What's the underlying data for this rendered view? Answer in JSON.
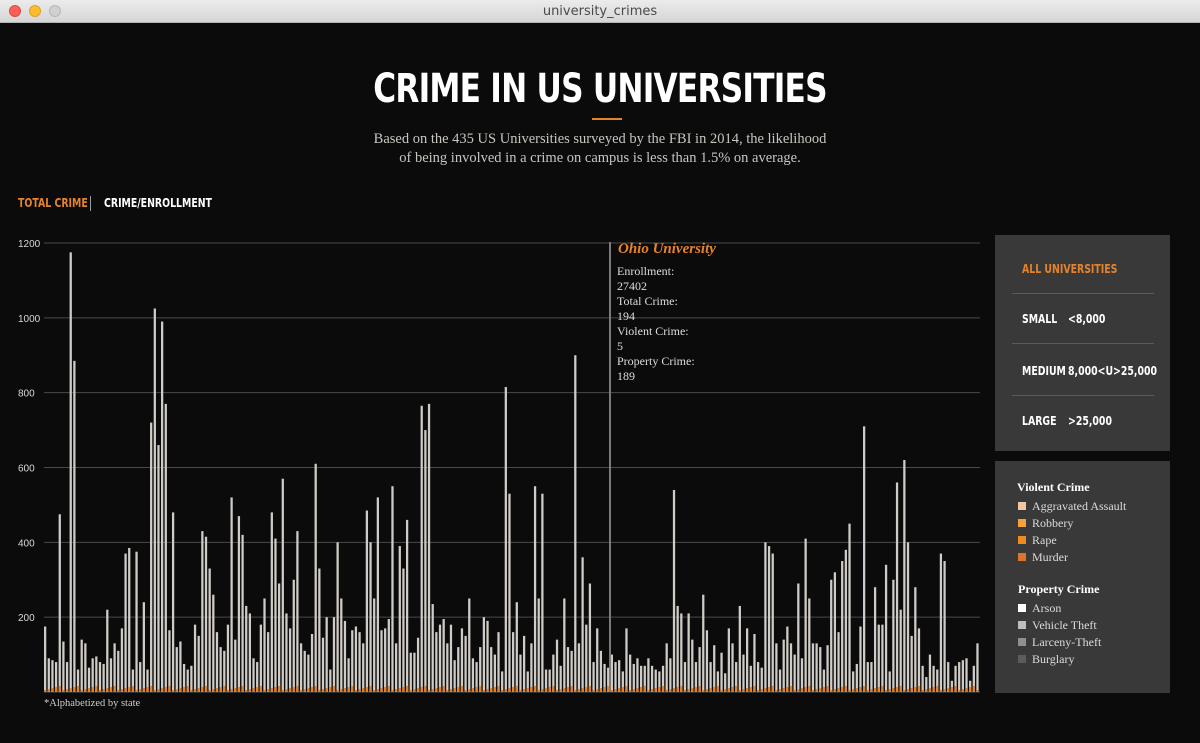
{
  "window": {
    "title": "university_crimes"
  },
  "header": {
    "title": "CRIME IN US UNIVERSITIES",
    "subtitle_line1": "Based on the 435 US Universities surveyed by the FBI in 2014, the likelihood",
    "subtitle_line2": "of being involved in a crime on campus is less than 1.5% on average."
  },
  "tabs": {
    "total": "TOTAL CRIME",
    "ratio": "CRIME/ENROLLMENT"
  },
  "size_filter": {
    "all": "ALL UNIVERSITIES",
    "small": {
      "label": "SMALL",
      "range": "<8,000"
    },
    "medium": {
      "label": "MEDIUM",
      "range": "8,000<U>25,000"
    },
    "large": {
      "label": "LARGE",
      "range": ">25,000"
    }
  },
  "legend": {
    "violent_title": "Violent Crime",
    "violent": [
      {
        "label": "Aggravated Assault",
        "color": "#f3c6a2"
      },
      {
        "label": "Robbery",
        "color": "#f6a23a"
      },
      {
        "label": "Rape",
        "color": "#f08a1f"
      },
      {
        "label": "Murder",
        "color": "#e0742a"
      }
    ],
    "property_title": "Property Crime",
    "property": [
      {
        "label": "Arson",
        "color": "#ffffff"
      },
      {
        "label": "Vehicle Theft",
        "color": "#bdbdbd"
      },
      {
        "label": "Larceny-Theft",
        "color": "#8f8f8f"
      },
      {
        "label": "Burglary",
        "color": "#5c5c5c"
      }
    ]
  },
  "footnote": "*Alphabetized by state",
  "tooltip": {
    "name": "Ohio University",
    "enrollment_label": "Enrollment:",
    "enrollment": "27402",
    "total_label": "Total Crime:",
    "total": "194",
    "violent_label": "Violent Crime:",
    "violent": "5",
    "property_label": "Property Crime:",
    "property": "189"
  },
  "chart_data": {
    "type": "bar",
    "stacked": true,
    "highlighted": "Ohio University",
    "y_ticks": [
      "200",
      "400",
      "600",
      "800",
      "1000",
      "1200"
    ],
    "ylim": [
      0,
      1200
    ],
    "values": [
      175,
      90,
      85,
      80,
      475,
      135,
      80,
      1175,
      885,
      60,
      140,
      130,
      65,
      90,
      95,
      80,
      75,
      220,
      90,
      130,
      110,
      170,
      370,
      385,
      60,
      375,
      80,
      240,
      60,
      720,
      1025,
      660,
      990,
      770,
      165,
      480,
      120,
      135,
      75,
      60,
      70,
      180,
      150,
      430,
      415,
      330,
      260,
      160,
      120,
      110,
      180,
      520,
      140,
      470,
      420,
      230,
      210,
      90,
      80,
      180,
      250,
      160,
      480,
      410,
      290,
      570,
      210,
      170,
      300,
      430,
      130,
      110,
      100,
      155,
      610,
      330,
      145,
      200,
      60,
      200,
      400,
      250,
      190,
      90,
      165,
      175,
      160,
      130,
      485,
      400,
      250,
      520,
      165,
      170,
      195,
      550,
      130,
      390,
      330,
      460,
      105,
      105,
      145,
      765,
      700,
      770,
      235,
      160,
      180,
      195,
      130,
      180,
      85,
      120,
      170,
      150,
      250,
      90,
      80,
      120,
      200,
      190,
      120,
      100,
      160,
      55,
      815,
      530,
      160,
      240,
      100,
      150,
      55,
      130,
      550,
      250,
      530,
      60,
      60,
      100,
      140,
      70,
      250,
      120,
      110,
      900,
      130,
      360,
      180,
      290,
      80,
      170,
      110,
      75,
      65,
      100,
      80,
      85,
      55,
      170,
      100,
      75,
      90,
      70,
      70,
      90,
      70,
      60,
      55,
      70,
      130,
      90,
      540,
      230,
      210,
      80,
      210,
      140,
      80,
      120,
      260,
      165,
      80,
      125,
      55,
      105,
      50,
      170,
      130,
      80,
      230,
      100,
      170,
      70,
      155,
      80,
      65,
      400,
      390,
      370,
      130,
      60,
      140,
      175,
      130,
      100,
      290,
      90,
      410,
      250,
      130,
      130,
      120,
      60,
      125,
      300,
      320,
      160,
      350,
      380,
      450,
      55,
      75,
      175,
      710,
      80,
      80,
      280,
      180,
      180,
      340,
      55,
      300,
      560,
      220,
      620,
      400,
      150,
      280,
      170,
      70,
      40,
      100,
      70,
      60,
      370,
      350,
      80,
      30,
      70,
      80,
      85,
      90,
      30,
      70,
      130
    ]
  }
}
